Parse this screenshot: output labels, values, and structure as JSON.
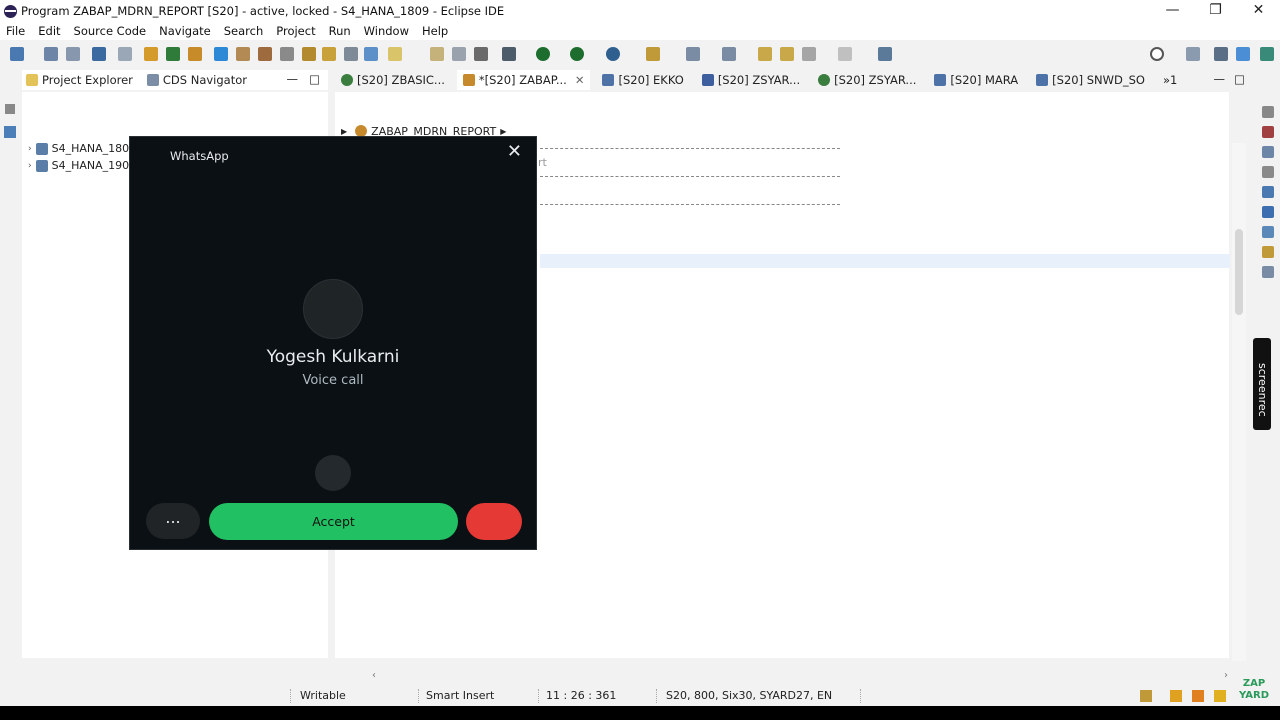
{
  "window": {
    "title": "Program ZABAP_MDRN_REPORT [S20]  - active, locked - S4_HANA_1809 - Eclipse IDE",
    "minimize": "—",
    "restore": "❐",
    "close": "✕"
  },
  "menu": [
    "File",
    "Edit",
    "Source Code",
    "Navigate",
    "Search",
    "Project",
    "Run",
    "Window",
    "Help"
  ],
  "left_tabs": {
    "project_explorer": "Project Explorer",
    "cds_navigator": "CDS Navigator"
  },
  "tree": {
    "item1": "S4_HANA_180",
    "item2": "S4_HANA_190"
  },
  "editor_tabs": [
    "[S20] ZBASIC...",
    "*[S20] ZABAP...",
    "[S20] EKKO",
    "[S20] ZSYAR...",
    "[S20] ZSYAR...",
    "[S20] MARA",
    "[S20] SNWD_SO",
    "»1"
  ],
  "breadcrumb": "ZABAP_MDRN_REPORT",
  "editor_fragment": "rt",
  "statusbar": {
    "writable": "Writable",
    "insert_mode": "Smart Insert",
    "position": "11 : 26 : 361",
    "system": "S20, 800, Six30, SYARD27, EN"
  },
  "screenrec": "screenrec",
  "whatsapp": {
    "title": "WhatsApp",
    "close": "✕",
    "caller": "Yogesh Kulkarni",
    "call_type": "Voice call",
    "more": "...",
    "accept": "Accept"
  },
  "colors": {
    "accept": "#21c063",
    "decline": "#e53935",
    "popup_bg": "#0b1014"
  }
}
